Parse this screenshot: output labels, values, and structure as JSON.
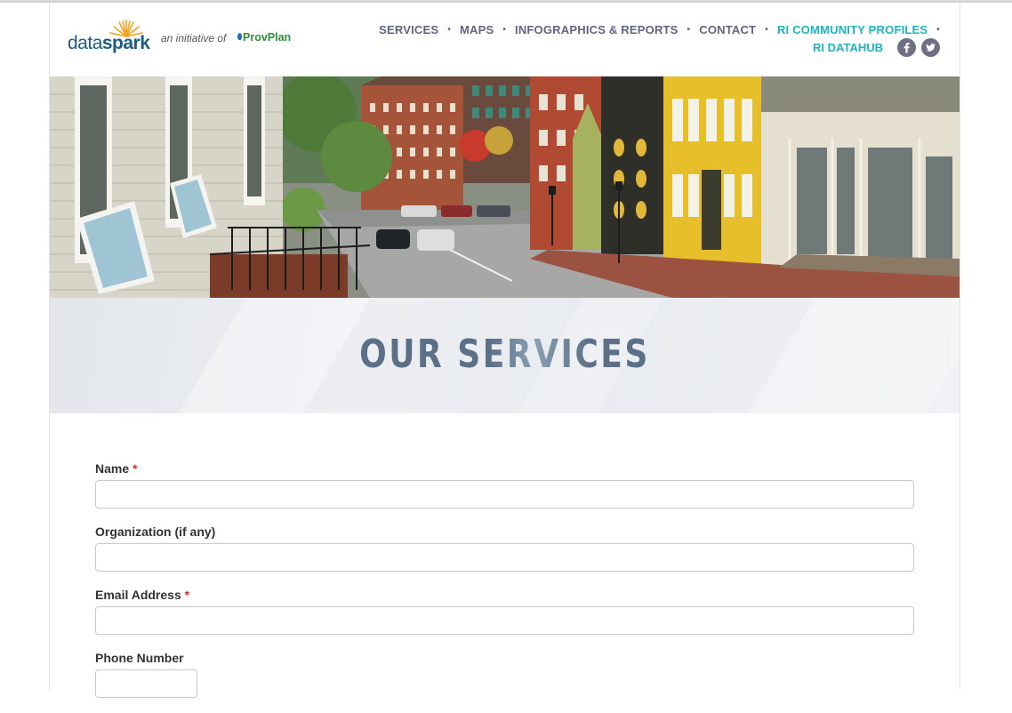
{
  "brand": {
    "logo_word_light": "data",
    "logo_word_bold": "spark",
    "tagline": "an initiative of",
    "partner": "ProvPlan"
  },
  "nav": {
    "items": [
      {
        "label": "SERVICES"
      },
      {
        "label": "MAPS"
      },
      {
        "label": "INFOGRAPHICS & REPORTS"
      },
      {
        "label": "CONTACT"
      },
      {
        "label": "RI COMMUNITY PROFILES"
      }
    ],
    "second_row": "RI DATAHUB",
    "social": [
      {
        "icon": "facebook-icon"
      },
      {
        "icon": "twitter-icon"
      }
    ]
  },
  "banner": {
    "title": "OUR SERVICES"
  },
  "form": {
    "fields": [
      {
        "label": "Name",
        "required": "*",
        "value": ""
      },
      {
        "label": "Organization (if any)",
        "required": "",
        "value": ""
      },
      {
        "label": "Email Address",
        "required": "*",
        "value": ""
      },
      {
        "label": "Phone Number",
        "required": "",
        "value": ""
      }
    ]
  },
  "colors": {
    "nav_gray": "#5d6680",
    "nav_teal": "#1bb4bf",
    "brand_blue": "#1d5b87",
    "partner_green": "#2f8f3a",
    "required_red": "#c0392b"
  }
}
